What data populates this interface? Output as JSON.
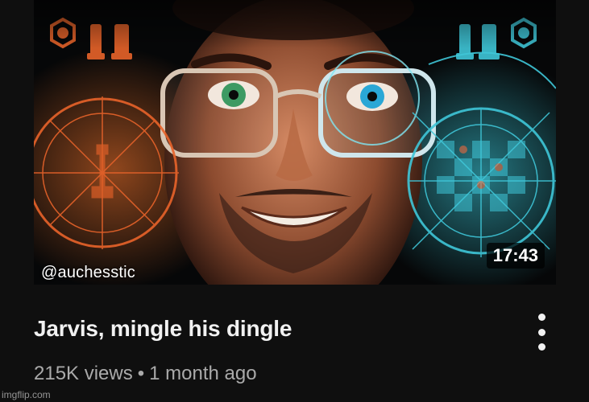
{
  "video": {
    "channel_handle": "@auchesstic",
    "duration": "17:43",
    "title": "Jarvis, mingle his dingle",
    "views": "215K views",
    "separator": "•",
    "age": "1 month ago"
  },
  "watermark": {
    "site": "imgflip.com"
  },
  "colors": {
    "background": "#0f0f0f",
    "title_text": "#f1f1f1",
    "meta_text": "#aaaaaa",
    "left_hud": "#e8632a",
    "right_hud": "#3fc6d8"
  },
  "icons": [
    "more-options-icon"
  ]
}
